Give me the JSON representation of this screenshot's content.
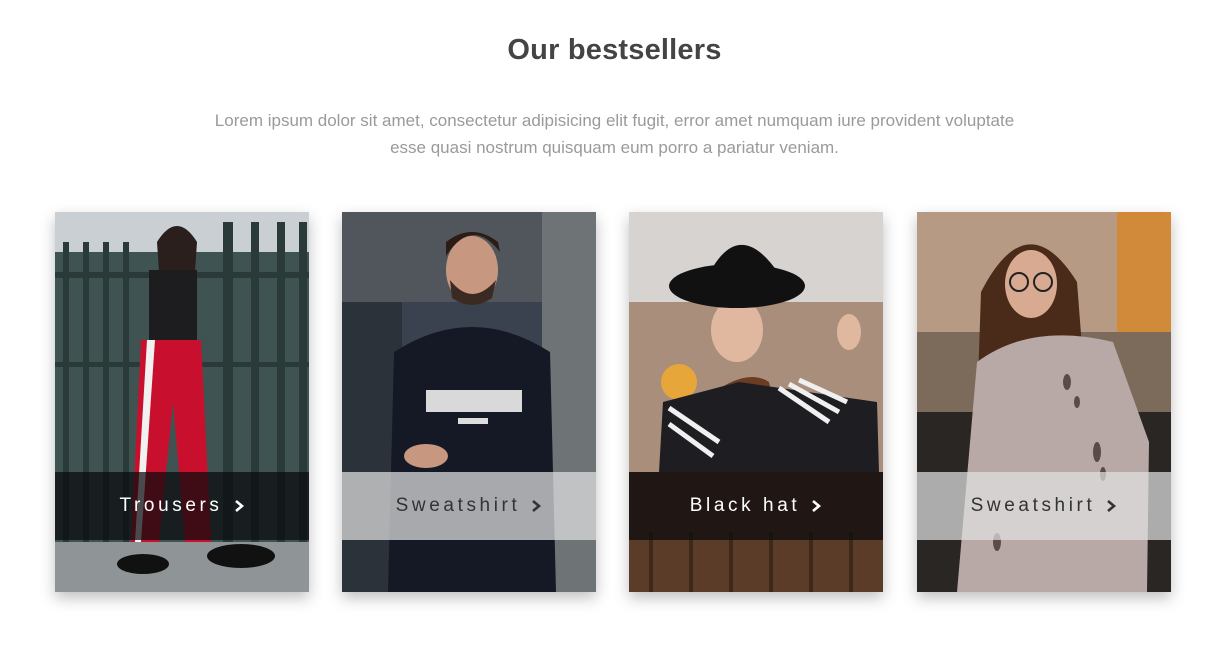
{
  "heading": "Our bestsellers",
  "intro_line1": "Lorem ipsum dolor sit amet, consectetur adipisicing elit fugit, error amet numquam iure provident voluptate",
  "intro_line2": "esse quasi nostrum quisquam eum porro a pariatur veniam.",
  "products": [
    {
      "label": "Trousers",
      "overlay": "dark"
    },
    {
      "label": "Sweatshirt",
      "overlay": "light"
    },
    {
      "label": "Black hat",
      "overlay": "dark"
    },
    {
      "label": "Sweatshirt",
      "overlay": "light"
    }
  ],
  "icons": {
    "card_arrow": "chevron-right-icon"
  },
  "colors": {
    "heading": "#444444",
    "intro_text": "#9a9a9a",
    "overlay_dark": "#0a0a0c",
    "overlay_light": "#e1e1e1"
  }
}
